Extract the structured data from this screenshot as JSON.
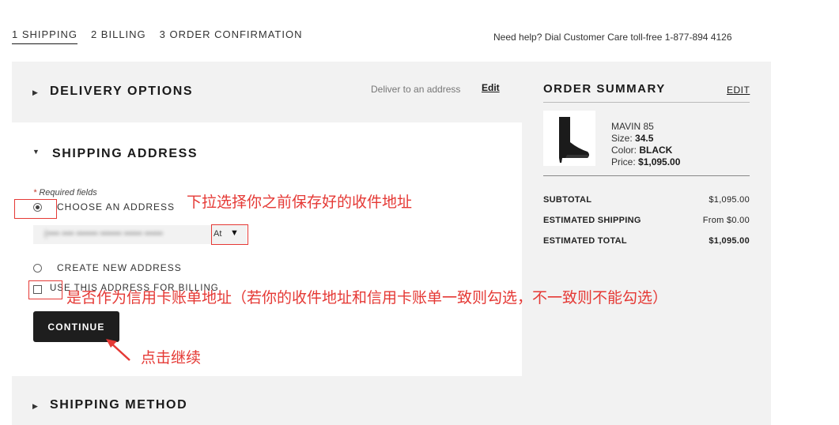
{
  "steps": [
    {
      "label": "1 SHIPPING"
    },
    {
      "label": "2 BILLING"
    },
    {
      "label": "3 ORDER CONFIRMATION"
    }
  ],
  "help_text": "Need help? Dial Customer Care toll-free 1-877-894 4126",
  "delivery": {
    "title": "DELIVERY OPTIONS",
    "note": "Deliver to an address",
    "edit_label": "Edit"
  },
  "shipping_address": {
    "title": "SHIPPING ADDRESS",
    "required_star": "*",
    "required_text": " Required fields",
    "choose_label": "CHOOSE AN ADDRESS",
    "select_value": "(•••• •••• ••••••• ••••••• •••••• ••••••",
    "select_tail": "At",
    "create_label": "CREATE NEW ADDRESS",
    "billing_label": "USE THIS ADDRESS FOR BILLING",
    "continue_label": "CONTINUE"
  },
  "shipping_method": {
    "title": "SHIPPING METHOD"
  },
  "summary": {
    "title": "ORDER SUMMARY",
    "edit_label": "EDIT",
    "product": {
      "name": "MAVIN 85",
      "size_label": "Size: ",
      "size_value": "34.5",
      "color_label": "Color: ",
      "color_value": "BLACK",
      "price_label": "Price: ",
      "price_value": "$1,095.00"
    },
    "rows": [
      {
        "label": "SUBTOTAL",
        "value": "$1,095.00"
      },
      {
        "label": "ESTIMATED SHIPPING",
        "value": "From $0.00"
      },
      {
        "label": "ESTIMATED TOTAL",
        "value": "$1,095.00"
      }
    ]
  },
  "annotations": {
    "dropdown_hint": "下拉选择你之前保存好的收件地址",
    "billing_hint": "是否作为信用卡账单地址（若你的收件地址和信用卡账单一致则勾选，不一致则不能勾选）",
    "continue_hint": "点击继续",
    "color": "#e53935"
  },
  "icons": {
    "collapsed": "triangle-right-icon",
    "expanded": "triangle-down-icon",
    "dropdown": "caret-down-icon",
    "annotation_arrow": "red-arrow-icon"
  }
}
